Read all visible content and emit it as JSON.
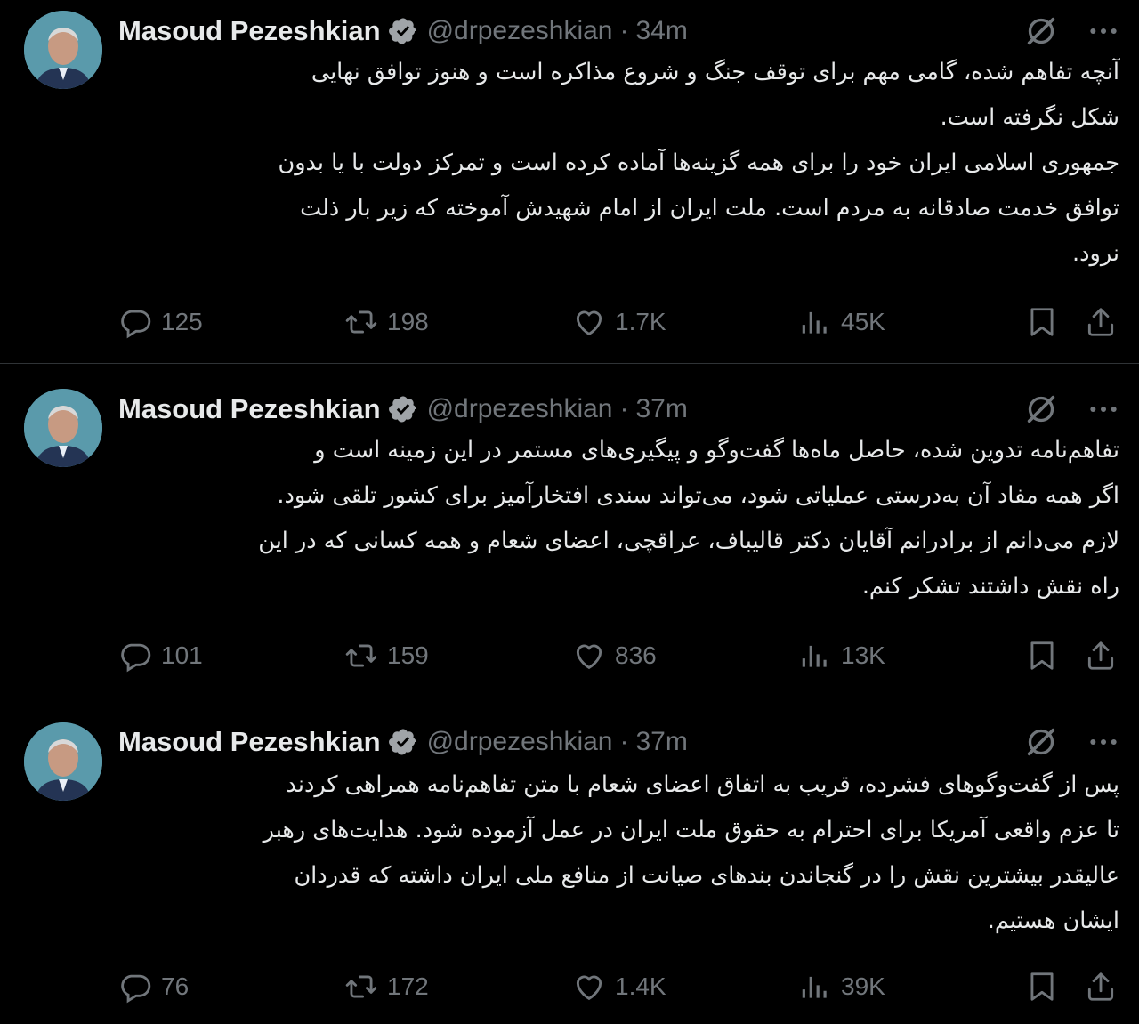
{
  "tweets": [
    {
      "author_name": "Masoud Pezeshkian",
      "handle": "@drpezeshkian",
      "separator": "·",
      "time": "34m",
      "lines": [
        "آنچه تفاهم شده، گامی مهم برای توقف جنگ و شروع مذاکره است و هنوز توافق نهایی",
        "شکل نگرفته است.",
        "جمهوری اسلامی ایران خود را برای همه گزینه‌ها آماده کرده است و تمرکز دولت با یا بدون",
        "توافق خدمت صادقانه به مردم است. ملت ایران از امام شهیدش آموخته که زیر بار ذلت",
        "نرود."
      ],
      "replies": "125",
      "reposts": "198",
      "likes": "1.7K",
      "views": "45K"
    },
    {
      "author_name": "Masoud Pezeshkian",
      "handle": "@drpezeshkian",
      "separator": "·",
      "time": "37m",
      "lines": [
        "تفاهم‌نامه تدوین شده، حاصل ماه‌ها گفت‌وگو و پیگیری‌های مستمر در این زمینه است و",
        "اگر همه مفاد آن به‌درستی عملیاتی شود، می‌تواند سندی افتخارآمیز برای کشور تلقی شود.",
        "لازم می‌دانم از برادرانم آقایان دکتر قالیباف، عراقچی، اعضای شعام و همه کسانی که در این",
        "راه نقش داشتند تشکر کنم."
      ],
      "replies": "101",
      "reposts": "159",
      "likes": "836",
      "views": "13K"
    },
    {
      "author_name": "Masoud Pezeshkian",
      "handle": "@drpezeshkian",
      "separator": "·",
      "time": "37m",
      "lines": [
        "پس از گفت‌وگوهای فشرده، قریب به اتفاق اعضای شعام با متن تفاهم‌نامه همراهی کردند",
        "تا عزم واقعی آمریکا برای احترام به حقوق ملت ایران در عمل آزموده شود. هدایت‌های رهبر",
        "عالیقدر بیشترین نقش را در گنجاندن بندهای صیانت از منافع ملی ایران داشته که قدردان",
        "ایشان هستیم."
      ],
      "replies": "76",
      "reposts": "172",
      "likes": "1.4K",
      "views": "39K"
    }
  ],
  "colors": {
    "background": "#000000",
    "text": "#e7e9ea",
    "muted": "#71767b",
    "divider": "#2f3336"
  },
  "icons": [
    "verified-badge-icon",
    "grok-icon",
    "more-icon",
    "reply-icon",
    "repost-icon",
    "like-icon",
    "views-icon",
    "bookmark-icon",
    "share-icon"
  ]
}
